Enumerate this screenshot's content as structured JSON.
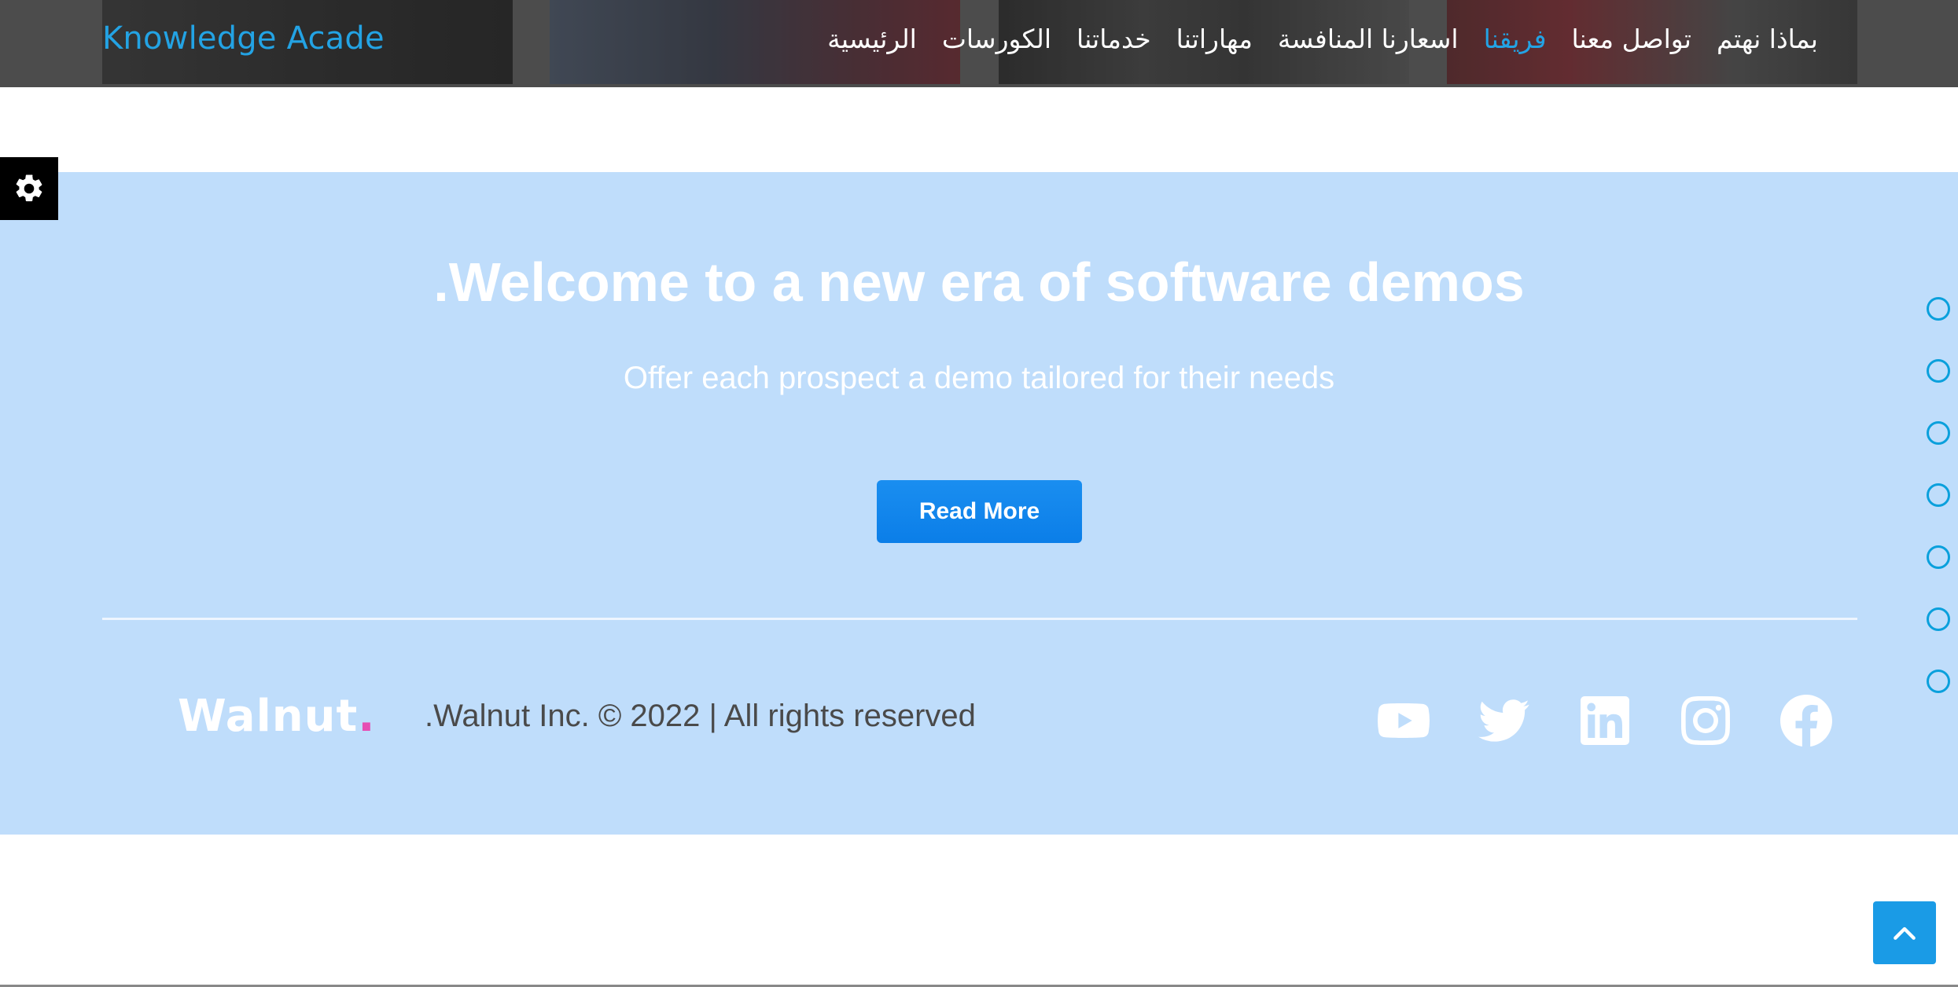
{
  "navbar": {
    "brand": "Knowledge Acade",
    "items": [
      {
        "label": "الرئيسية"
      },
      {
        "label": "الكورسات"
      },
      {
        "label": "خدماتنا"
      },
      {
        "label": "مهاراتنا"
      },
      {
        "label": "اسعارنا المنافسة"
      },
      {
        "label": "فريقنا"
      },
      {
        "label": "تواصل معنا"
      },
      {
        "label": "بماذا نهتم"
      }
    ],
    "active_index": 5
  },
  "hero": {
    "title": ".Welcome to a new era of software demos",
    "subtitle": "Offer each prospect a demo tailored for their needs",
    "button_label": "Read More"
  },
  "footer": {
    "logo_text": "Walnut",
    "logo_dot": ".",
    "copyright": ".Walnut Inc. © 2022 | All rights reserved",
    "socials": [
      "youtube-icon",
      "twitter-icon",
      "linkedin-icon",
      "instagram-icon",
      "facebook-icon"
    ]
  },
  "slider": {
    "dot_count": 7
  },
  "colors": {
    "accent": "#23a3e4",
    "hero_bg": "#bfddfb",
    "button": "#0b7ee8",
    "logo_dot": "#e64db3"
  },
  "icons": {
    "settings": "gear-icon",
    "back_to_top": "chevron-up-icon"
  }
}
